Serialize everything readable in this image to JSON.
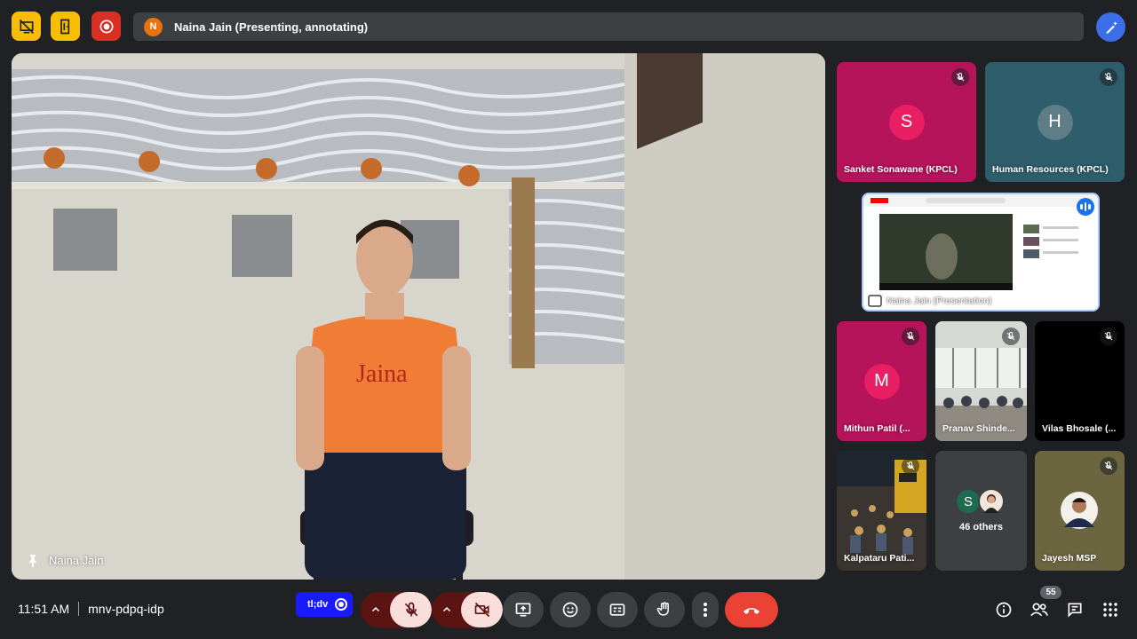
{
  "header": {
    "presenter_initial": "N",
    "presenter_status": "Naina Jain (Presenting, annotating)",
    "buttons": [
      "hide-self-view-icon",
      "door-exit-icon",
      "recording-icon"
    ],
    "ai_button_icon": "pen-sparkle-icon"
  },
  "main_stage": {
    "participant_name": "Naina Jain",
    "pinned": true,
    "shirt_text": "Jaina"
  },
  "tiles": [
    {
      "name": "Sanket Sonawane (KPCL)",
      "initial": "S",
      "bg": "#b5135a",
      "avatar_bg": "#e91e63",
      "muted": true
    },
    {
      "name": "Human Resources (KPCL)",
      "initial": "H",
      "bg": "#2e5d6b",
      "avatar_bg": "#5f7d87",
      "muted": true
    },
    {
      "name": "Mithun Patil (...",
      "initial": "M",
      "bg": "#b5135a",
      "avatar_bg": "#e91e63",
      "muted": true
    },
    {
      "name": "Pranav Shinde...",
      "muted": true
    },
    {
      "name": "Vilas Bhosale (...",
      "muted": true
    },
    {
      "name": "Kalpataru Pati...",
      "muted": true
    },
    {
      "name": "Jayesh MSP",
      "muted": true
    }
  ],
  "presentation": {
    "label": "Naina Jain (Presentation)",
    "speaking": true
  },
  "others": {
    "initial": "S",
    "label": "46 others",
    "avatar_bg": "#1e6b52"
  },
  "footer": {
    "time": "11:51 AM",
    "meeting_code": "mnv-pdpq-idp",
    "live_badge": "tl;dv",
    "participant_count": "55"
  },
  "controls": [
    "chevron-up-icon",
    "mic-off-icon",
    "chevron-up-icon",
    "camera-off-icon",
    "present-screen-icon",
    "emoji-icon",
    "captions-icon",
    "raise-hand-icon",
    "more-options-icon",
    "end-call-icon"
  ],
  "colors": {
    "background": "#202124",
    "accent_yellow": "#fbbc04",
    "record_red": "#d93025",
    "end_call": "#ea4335",
    "live_blue": "#1a1aff"
  }
}
